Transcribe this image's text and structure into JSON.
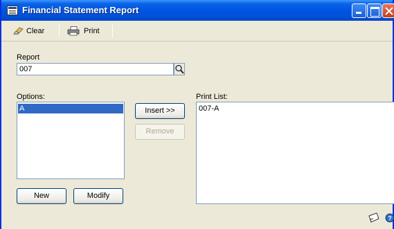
{
  "window": {
    "title": "Financial Statement Report"
  },
  "toolbar": {
    "clear_label": "Clear",
    "print_label": "Print"
  },
  "report": {
    "label": "Report",
    "value": "007"
  },
  "options": {
    "label": "Options:",
    "items": [
      "A"
    ],
    "selected": "A"
  },
  "print_list": {
    "label": "Print List:",
    "items": [
      "007-A"
    ]
  },
  "buttons": {
    "insert": "Insert >>",
    "remove": "Remove",
    "new": "New",
    "modify": "Modify"
  }
}
